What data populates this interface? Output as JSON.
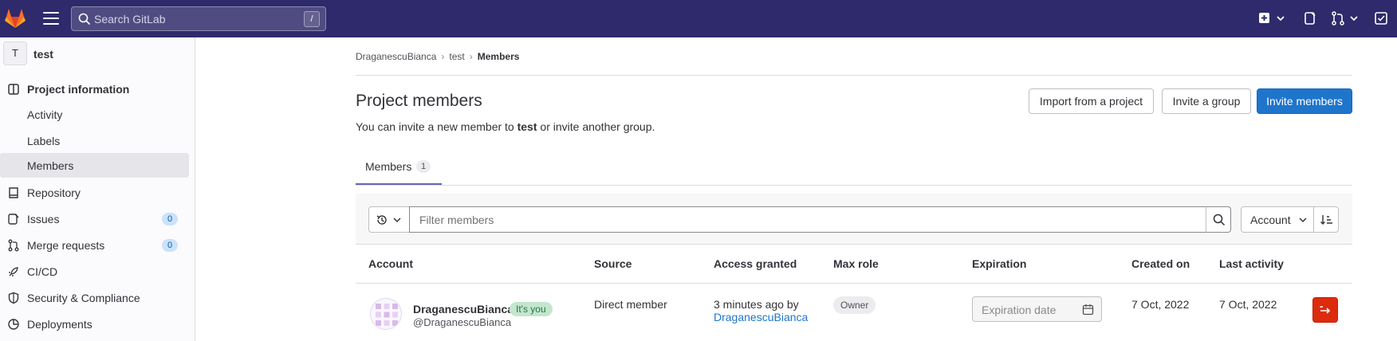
{
  "topbar": {
    "search_placeholder": "Search GitLab",
    "search_shortcut": "/",
    "icons": [
      "gitlab-logo",
      "hamburger-icon",
      "search-icon",
      "create-new-icon",
      "chevron-down-icon",
      "issues-icon",
      "merge-requests-icon",
      "chevron-down-icon",
      "todo-icon"
    ],
    "colors": {
      "background": "#2f2a6b"
    }
  },
  "sidebar": {
    "project_avatar_letter": "T",
    "project_name": "test",
    "items": [
      {
        "label": "Project information",
        "icon": "project-icon",
        "bold": true
      },
      {
        "label": "Activity",
        "sub": true
      },
      {
        "label": "Labels",
        "sub": true
      },
      {
        "label": "Members",
        "sub": true,
        "active": true
      },
      {
        "label": "Repository",
        "icon": "repository-icon"
      },
      {
        "label": "Issues",
        "icon": "issues-icon",
        "count": "0"
      },
      {
        "label": "Merge requests",
        "icon": "merge-request-icon",
        "count": "0"
      },
      {
        "label": "CI/CD",
        "icon": "rocket-icon"
      },
      {
        "label": "Security & Compliance",
        "icon": "shield-icon"
      },
      {
        "label": "Deployments",
        "icon": "deployments-icon"
      }
    ]
  },
  "breadcrumb": [
    "DraganescuBianca",
    "test",
    "Members"
  ],
  "header": {
    "title": "Project members",
    "subtitle_pre": "You can invite a new member to ",
    "subtitle_project": "test",
    "subtitle_post": " or invite another group.",
    "buttons": {
      "import": "Import from a project",
      "invite_group": "Invite a group",
      "invite_members": "Invite members"
    },
    "colors": {
      "primary": "#1f75cb"
    }
  },
  "tabs": [
    {
      "label": "Members",
      "count": "1"
    }
  ],
  "filter": {
    "placeholder": "Filter members",
    "sort_label": "Account"
  },
  "table": {
    "columns": [
      "Account",
      "Source",
      "Access granted",
      "Max role",
      "Expiration",
      "Created on",
      "Last activity"
    ],
    "rows": [
      {
        "name": "DraganescuBianca",
        "badge": "It's you",
        "username": "@DraganescuBianca",
        "source": "Direct member",
        "access_granted": "3 minutes ago by",
        "access_granted_by": "DraganescuBianca",
        "max_role": "Owner",
        "expiration_placeholder": "Expiration date",
        "created_on": "7 Oct, 2022",
        "last_activity": "7 Oct, 2022"
      }
    ],
    "colors": {
      "leave_button": "#dd2b0e",
      "badge_bg": "#c3e6cd"
    }
  }
}
